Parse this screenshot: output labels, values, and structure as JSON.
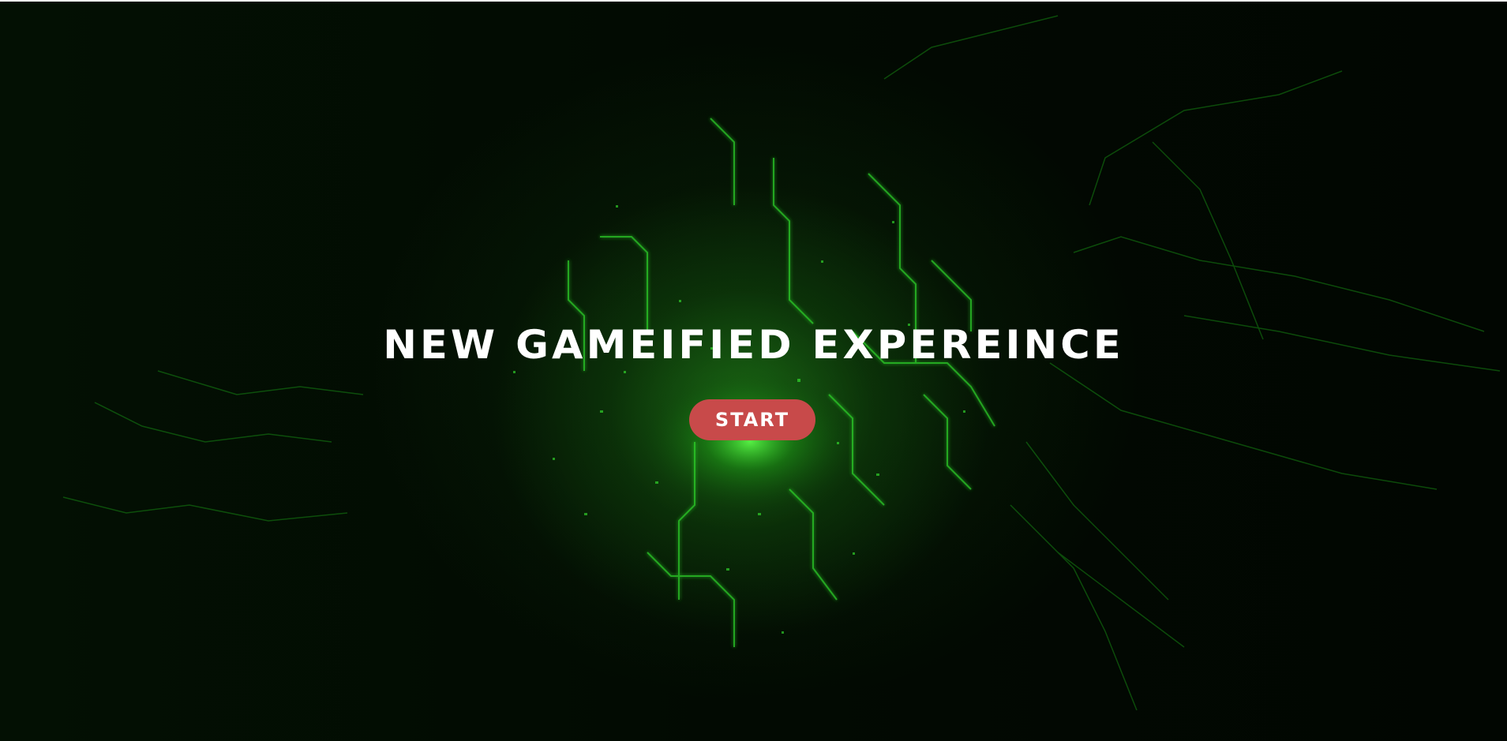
{
  "hero": {
    "title": "NEW GAMEIFIED EXPEREINCE",
    "start_label": "START"
  },
  "colors": {
    "background": "#020802",
    "circuit_glow": "#27e625",
    "button": "#c84a4a",
    "text": "#ffffff"
  }
}
